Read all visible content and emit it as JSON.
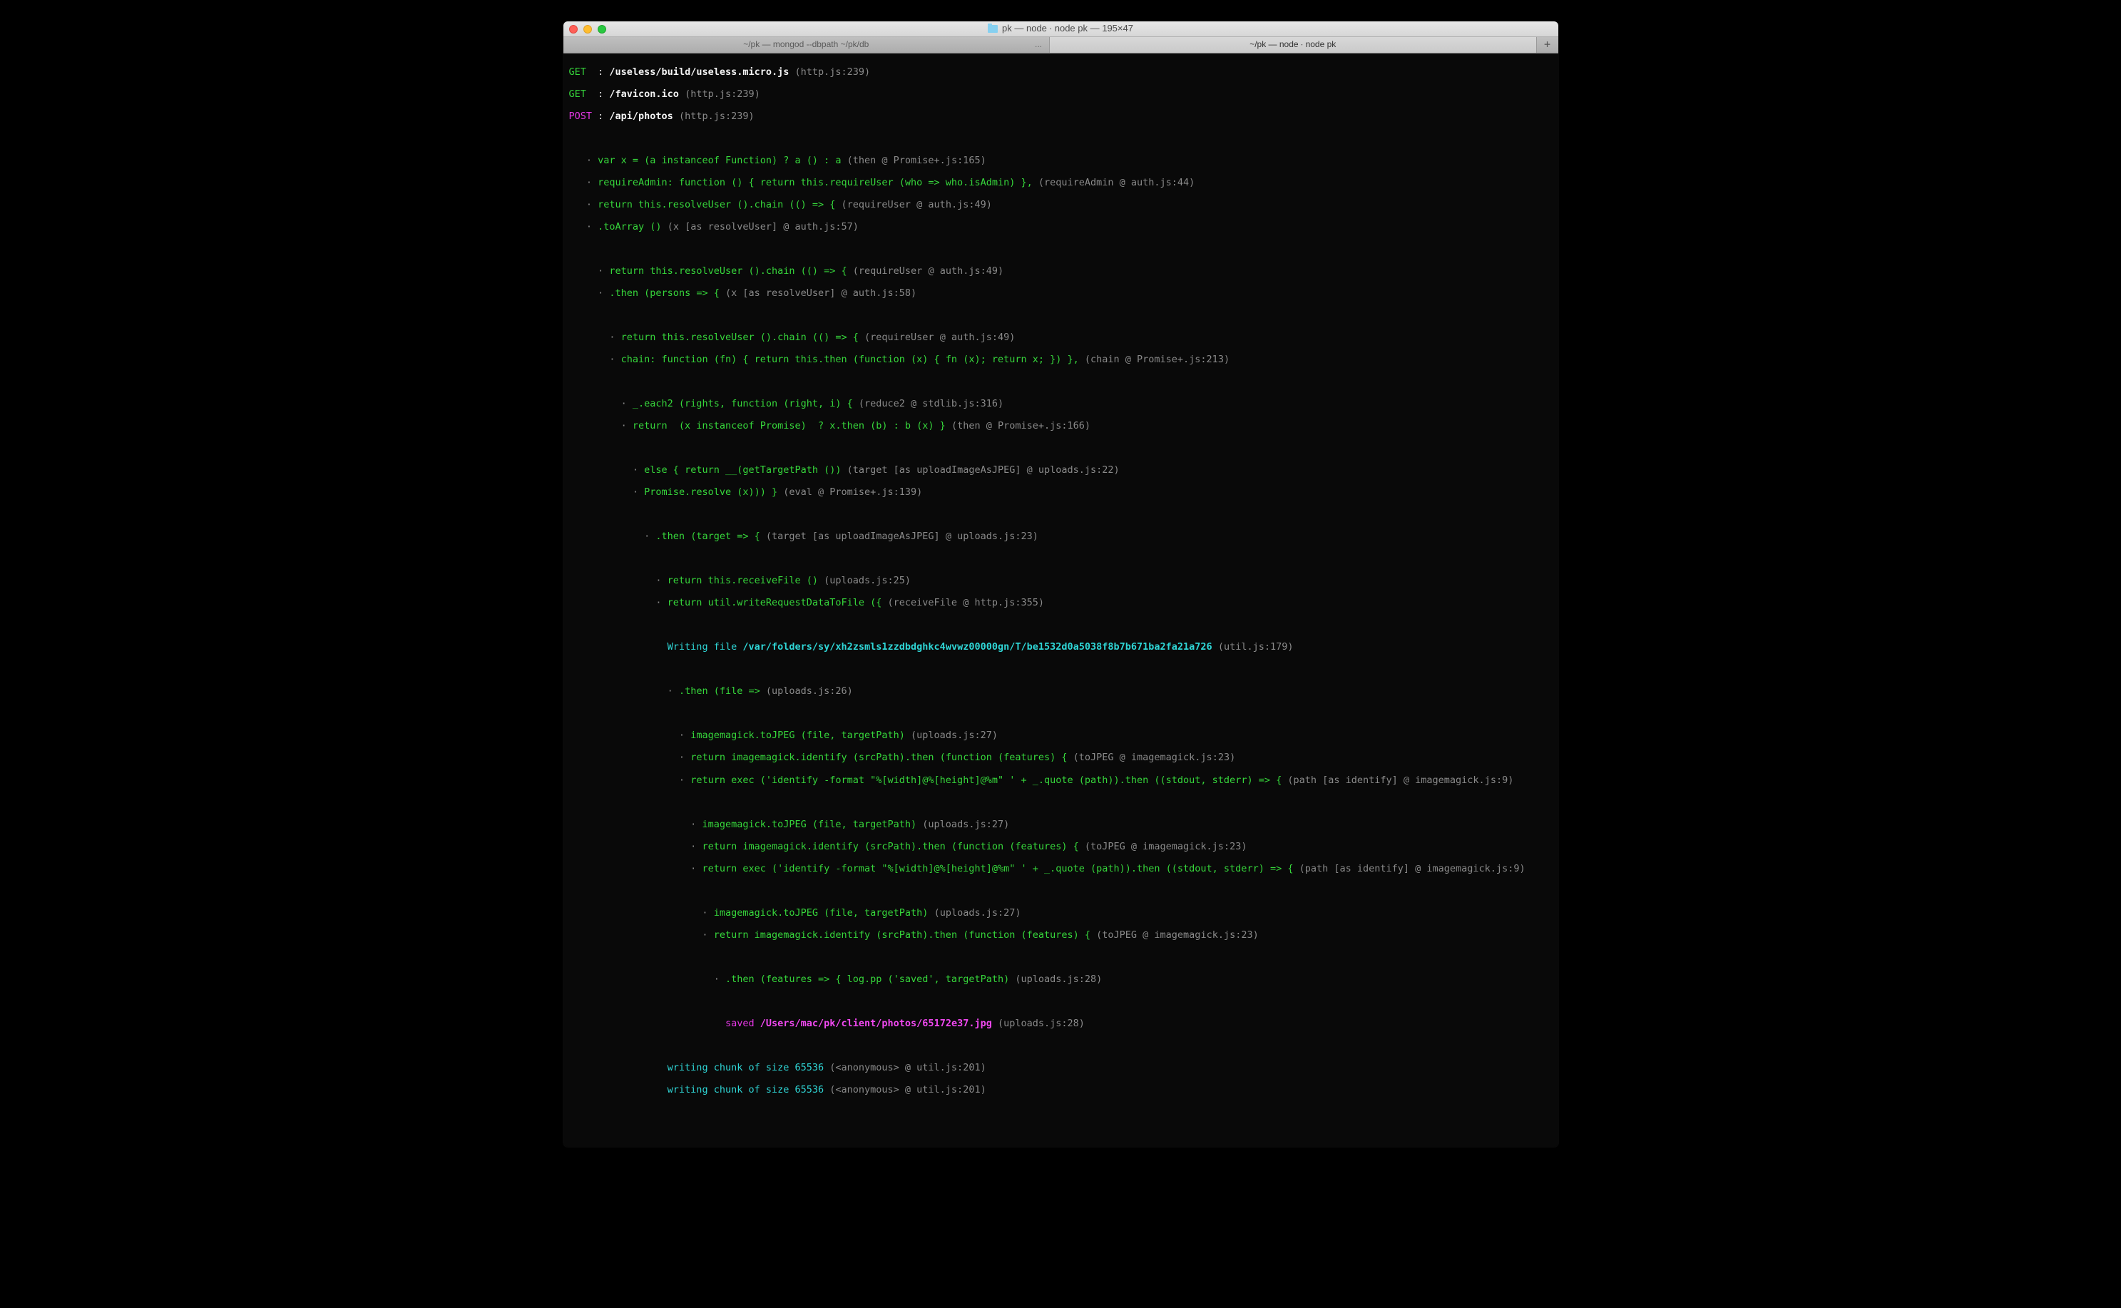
{
  "window": {
    "title": "pk — node ∙ node pk — 195×47"
  },
  "tabs": [
    {
      "label": "~/pk — mongod --dbpath ~/pk/db",
      "active": false,
      "overflow": "..."
    },
    {
      "label": "~/pk — node ∙ node pk",
      "active": true
    }
  ],
  "newtab": "+",
  "req": [
    {
      "method": "GET",
      "sep": "  : ",
      "path": "/useless/build/useless.micro.js",
      "src": "(http.js:239)"
    },
    {
      "method": "GET",
      "sep": "  : ",
      "path": "/favicon.ico",
      "src": "(http.js:239)"
    },
    {
      "method": "POST",
      "sep": " : ",
      "path": "/api/photos",
      "src": "(http.js:239)"
    }
  ],
  "b1": {
    "a": {
      "bul": "   · ",
      "code": "var x = (a instanceof Function) ? a () : a ",
      "src": "(then @ Promise+.js:165)"
    },
    "b": {
      "bul": "   · ",
      "code": "requireAdmin: function () { return this.requireUser (who => who.isAdmin) },",
      "src": " (requireAdmin @ auth.js:44)"
    },
    "c": {
      "bul": "   · ",
      "code": "return this.resolveUser ().chain (() => { ",
      "src": "(requireUser @ auth.js:49)"
    },
    "d": {
      "bul": "   · ",
      "code": ".toArray () ",
      "src": "(x [as resolveUser] @ auth.js:57)"
    }
  },
  "b2": {
    "a": {
      "bul": "     · ",
      "code": "return this.resolveUser ().chain (() => { ",
      "src": "(requireUser @ auth.js:49)"
    },
    "b": {
      "bul": "     · ",
      "code": ".then (persons => { ",
      "src": "(x [as resolveUser] @ auth.js:58)"
    }
  },
  "b3": {
    "a": {
      "bul": "       · ",
      "code": "return this.resolveUser ().chain (() => { ",
      "src": "(requireUser @ auth.js:49)"
    },
    "b": {
      "bul": "       · ",
      "code": "chain: function (fn) { return this.then (function (x) { fn (x); return x; }) },",
      "src": " (chain @ Promise+.js:213)"
    }
  },
  "b4": {
    "a": {
      "bul": "         · ",
      "code": "_.each2 (rights, function (right, i) { ",
      "src": "(reduce2 @ stdlib.js:316)"
    },
    "b": {
      "bul": "         · ",
      "code": "return  (x instanceof Promise)  ? x.then (b) : b (x) } ",
      "src": "(then @ Promise+.js:166)"
    }
  },
  "b5": {
    "a": {
      "bul": "           · ",
      "code": "else { return __(getTargetPath ()) ",
      "src": "(target [as uploadImageAsJPEG] @ uploads.js:22)"
    },
    "b": {
      "bul": "           · ",
      "code": "Promise.resolve (x))) } ",
      "src": "(eval @ Promise+.js:139)"
    }
  },
  "b6": {
    "a": {
      "bul": "             · ",
      "code": ".then (target => { ",
      "src": "(target [as uploadImageAsJPEG] @ uploads.js:23)"
    }
  },
  "b7": {
    "a": {
      "bul": "               · ",
      "code": "return this.receiveFile () ",
      "src": "(uploads.js:25)"
    },
    "b": {
      "bul": "               · ",
      "code": "return util.writeRequestDataToFile ({ ",
      "src": "(receiveFile @ http.js:355)"
    }
  },
  "wf": {
    "pre": "                 ",
    "label": "Writing file ",
    "path": "/var/folders/sy/xh2zsmls1zzdbdghkc4wvwz00000gn/T/be1532d0a5038f8b7b671ba2fa21a726",
    "src": " (util.js:179)"
  },
  "b8": {
    "a": {
      "bul": "                 · ",
      "code": ".then (file => ",
      "src": "(uploads.js:26)"
    }
  },
  "b9": {
    "a": {
      "bul": "                   · ",
      "code": "imagemagick.toJPEG (file, targetPath) ",
      "src": "(uploads.js:27)"
    },
    "b": {
      "bul": "                   · ",
      "code": "return imagemagick.identify (srcPath).then (function (features) { ",
      "src": "(toJPEG @ imagemagick.js:23)"
    },
    "c": {
      "bul": "                   · ",
      "code": "return exec ('identify -format \"%[width]@%[height]@%m\" ' + _.quote (path)).then ((stdout, stderr) => { ",
      "src": "(path [as identify] @ imagemagick.js:9)"
    }
  },
  "b10": {
    "a": {
      "bul": "                     · ",
      "code": "imagemagick.toJPEG (file, targetPath) ",
      "src": "(uploads.js:27)"
    },
    "b": {
      "bul": "                     · ",
      "code": "return imagemagick.identify (srcPath).then (function (features) { ",
      "src": "(toJPEG @ imagemagick.js:23)"
    },
    "c": {
      "bul": "                     · ",
      "code": "return exec ('identify -format \"%[width]@%[height]@%m\" ' + _.quote (path)).then ((stdout, stderr) => { ",
      "src": "(path [as identify] @ imagemagick.js:9)"
    }
  },
  "b11": {
    "a": {
      "bul": "                       · ",
      "code": "imagemagick.toJPEG (file, targetPath) ",
      "src": "(uploads.js:27)"
    },
    "b": {
      "bul": "                       · ",
      "code": "return imagemagick.identify (srcPath).then (function (features) { ",
      "src": "(toJPEG @ imagemagick.js:23)"
    }
  },
  "b12": {
    "a": {
      "bul": "                         · ",
      "code": ".then (features => { log.pp ('saved', targetPath) ",
      "src": "(uploads.js:28)"
    }
  },
  "sv": {
    "pre": "                           ",
    "label": "saved ",
    "path": "/Users/mac/pk/client/photos/65172e37.jpg",
    "src": " (uploads.js:28)"
  },
  "ch": {
    "pre": "                 ",
    "text": "writing chunk of size 65536",
    "src": " (<anonymous> @ util.js:201)"
  }
}
